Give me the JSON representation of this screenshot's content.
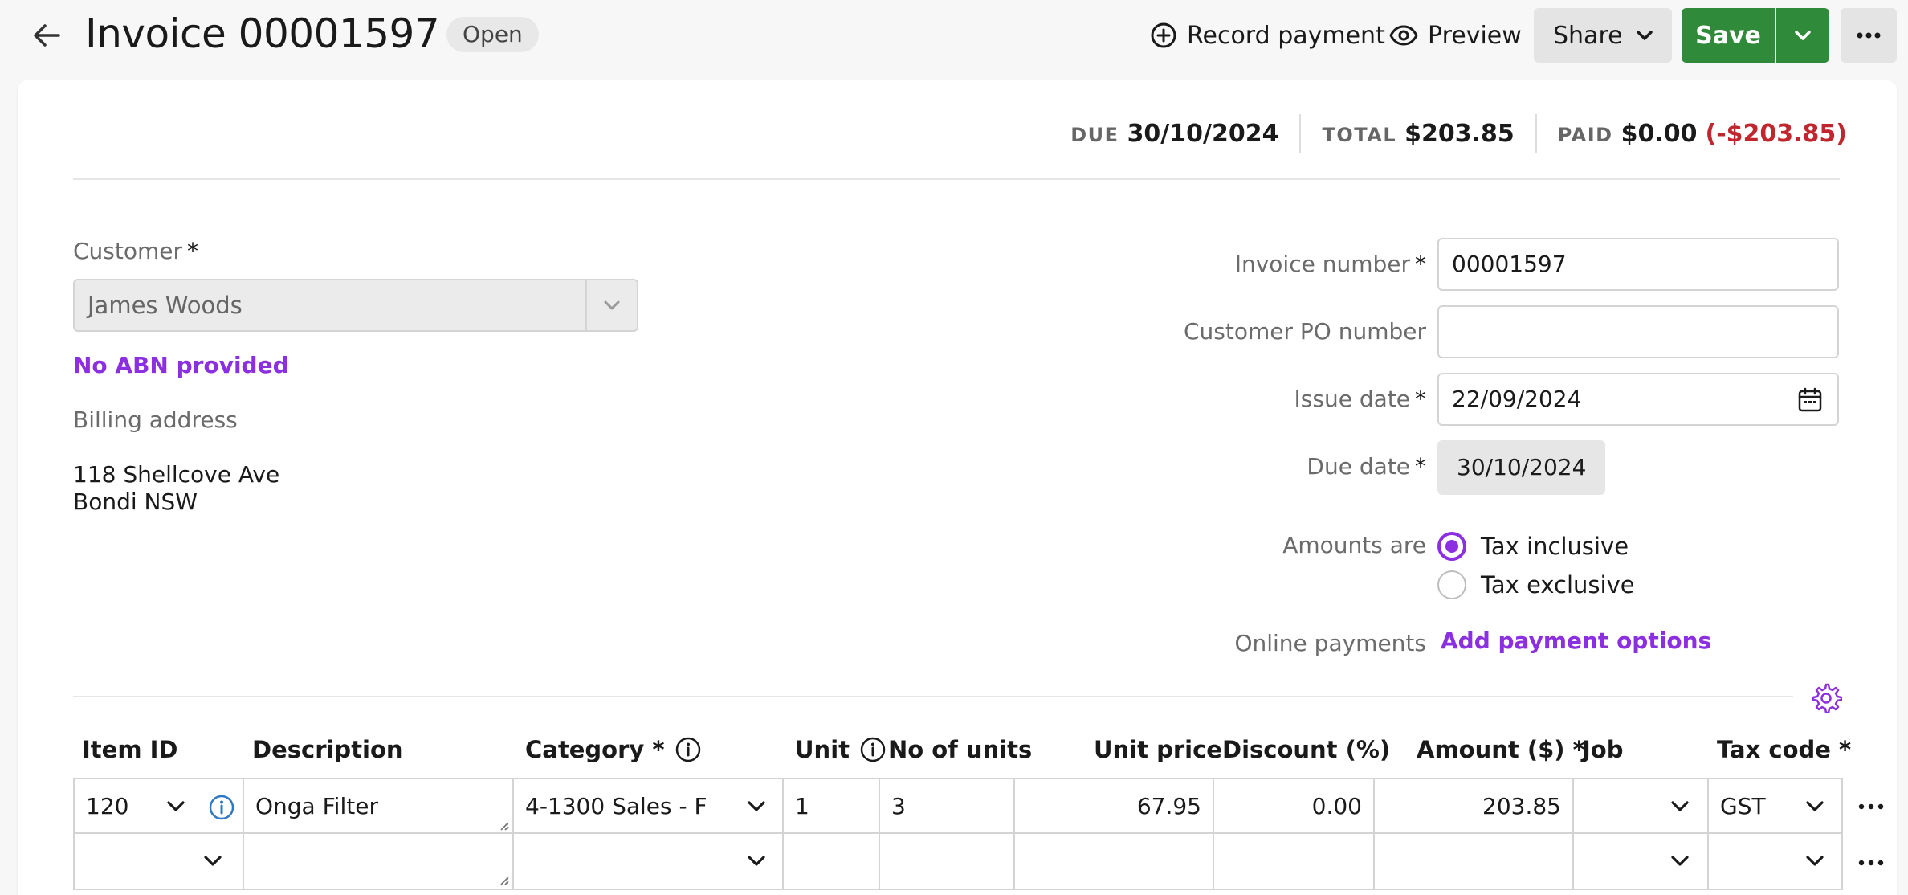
{
  "header": {
    "title": "Invoice 00001597",
    "status": "Open",
    "record_payment": "Record payment",
    "preview": "Preview",
    "share": "Share",
    "save": "Save"
  },
  "summary": {
    "due_label": "DUE",
    "due_value": "30/10/2024",
    "total_label": "TOTAL",
    "total_value": "$203.85",
    "paid_label": "PAID",
    "paid_value": "$0.00",
    "balance": "(-$203.85)"
  },
  "customer": {
    "label": "Customer",
    "required": "*",
    "value": "James Woods",
    "abn_link": "No ABN provided",
    "billing_label": "Billing address",
    "address_line1": "118 Shellcove Ave",
    "address_line2": "Bondi NSW"
  },
  "details": {
    "invoice_number_label": "Invoice number",
    "invoice_number": "00001597",
    "po_label": "Customer PO number",
    "po_value": "",
    "issue_date_label": "Issue date",
    "issue_date": "22/09/2024",
    "due_date_label": "Due date",
    "due_date": "30/10/2024",
    "amounts_label": "Amounts are",
    "tax_inclusive": "Tax inclusive",
    "tax_exclusive": "Tax exclusive",
    "amounts_selected": "Tax inclusive",
    "online_label": "Online payments",
    "online_link": "Add payment options"
  },
  "table": {
    "headers": {
      "item_id": "Item ID",
      "description": "Description",
      "category": "Category *",
      "unit": "Unit",
      "no_units": "No of units",
      "unit_price": "Unit price",
      "discount": "Discount (%)",
      "amount": "Amount ($) *",
      "job": "Job",
      "tax_code": "Tax code *"
    },
    "rows": [
      {
        "item_id": "120",
        "description": "Onga  Filter",
        "category": "4-1300  Sales - F",
        "unit": "1",
        "no_units": "3",
        "unit_price": "67.95",
        "discount": "0.00",
        "amount": "203.85",
        "job": "",
        "tax_code": "GST"
      },
      {
        "item_id": "",
        "description": "",
        "category": "",
        "unit": "",
        "no_units": "",
        "unit_price": "",
        "discount": "",
        "amount": "",
        "job": "",
        "tax_code": ""
      }
    ]
  },
  "colors": {
    "accent": "#8b2fe0",
    "save": "#2f8a3a",
    "negative": "#c0262d"
  }
}
